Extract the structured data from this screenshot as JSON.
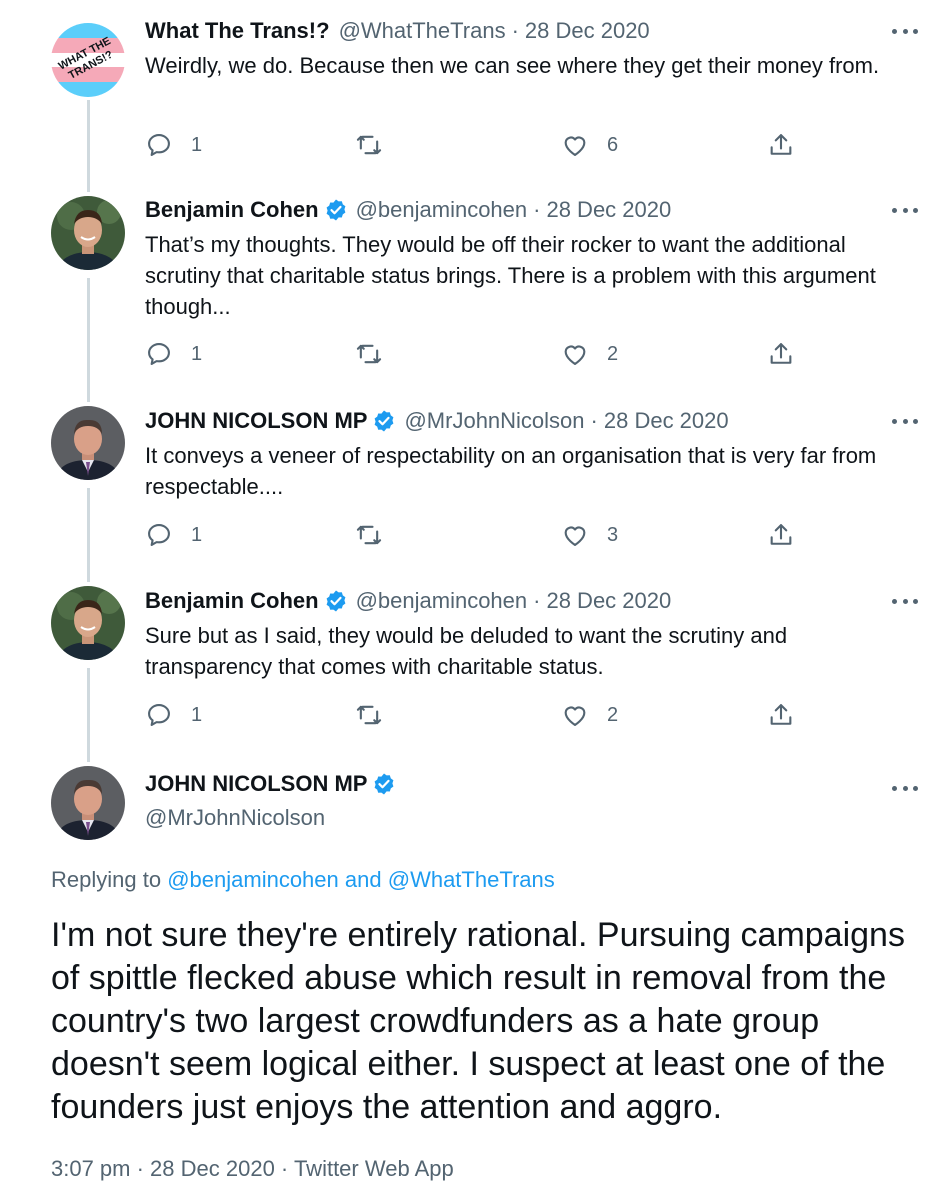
{
  "colors": {
    "accent": "#1d9bf0",
    "secondary_text": "#536471",
    "thread_line": "#cfd9de"
  },
  "tweets": [
    {
      "name": "What The Trans!?",
      "handle": "@WhatTheTrans",
      "sep": "·",
      "date": "28 Dec 2020",
      "verified": false,
      "avatar_text": "WHAT THE TRANS!?",
      "text": "Weirdly, we do. Because then we can see where they get their money from.",
      "replies": "1",
      "likes": "6"
    },
    {
      "name": "Benjamin Cohen",
      "handle": "@benjamincohen",
      "sep": "·",
      "date": "28 Dec 2020",
      "verified": true,
      "text": "That’s my thoughts. They would be off their rocker to want the additional scrutiny that charitable status brings. There is a problem with this argument though...",
      "replies": "1",
      "likes": "2"
    },
    {
      "name": "JOHN NICOLSON MP",
      "handle": "@MrJohnNicolson",
      "sep": "·",
      "date": "28 Dec 2020",
      "verified": true,
      "text": "It conveys a veneer of respectability on an organisation that is very far from respectable....",
      "replies": "1",
      "likes": "3"
    },
    {
      "name": "Benjamin Cohen",
      "handle": "@benjamincohen",
      "sep": "·",
      "date": "28 Dec 2020",
      "verified": true,
      "text": "Sure but as I said, they would be deluded to want the scrutiny and transparency that comes with charitable status.",
      "replies": "1",
      "likes": "2"
    }
  ],
  "main": {
    "name": "JOHN NICOLSON MP",
    "handle": "@MrJohnNicolson",
    "replying_prefix": "Replying to",
    "replying_user1": "@benjamincohen",
    "replying_and": "and",
    "replying_user2": "@WhatTheTrans",
    "text": "I'm not sure they're entirely rational. Pursuing campaigns of spittle flecked abuse which result in removal from the country's two largest crowdfunders as a hate group doesn't seem logical either. I suspect at least one of the founders just enjoys the attention and aggro.",
    "footer": "3:07 pm · 28 Dec 2020 · Twitter Web App"
  },
  "icons": {
    "reply": "reply-icon",
    "retweet": "retweet-icon",
    "like": "like-icon",
    "share": "share-icon",
    "verified": "verified-badge-icon",
    "more": "more-options-icon"
  }
}
